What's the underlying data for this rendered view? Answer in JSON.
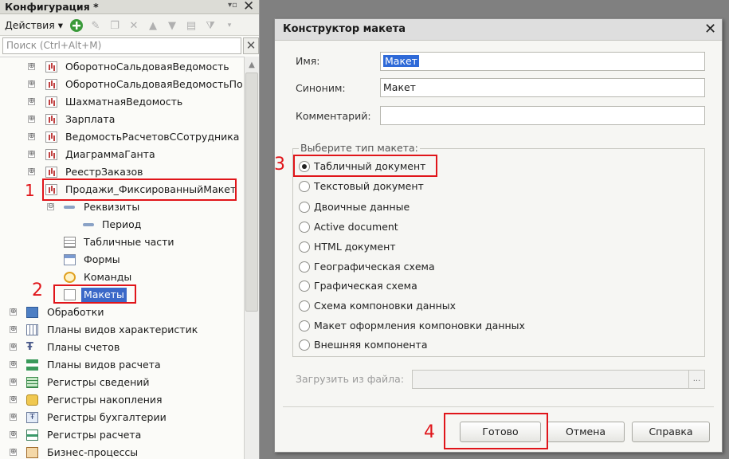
{
  "config_panel": {
    "title": "Конфигурация *",
    "actions_label": "Действия",
    "search_placeholder": "Поиск (Ctrl+Alt+M)",
    "tree": [
      {
        "label": "ОборотноСальдоваяВедомость",
        "icon": "report-icon",
        "expander": "⊕"
      },
      {
        "label": "ОборотноСальдоваяВедомостьПо",
        "icon": "report-icon",
        "expander": "⊕"
      },
      {
        "label": "ШахматнаяВедомость",
        "icon": "report-icon",
        "expander": "⊕"
      },
      {
        "label": "Зарплата",
        "icon": "report-icon",
        "expander": "⊕"
      },
      {
        "label": "ВедомостьРасчетовССотрудника",
        "icon": "report-icon",
        "expander": "⊕"
      },
      {
        "label": "ДиаграммаГанта",
        "icon": "report-icon",
        "expander": "⊕"
      },
      {
        "label": "РеестрЗаказов",
        "icon": "report-icon",
        "expander": "⊕"
      },
      {
        "label": "Продажи_ФиксированныйМакет",
        "icon": "report-icon",
        "expander": "⊖"
      },
      {
        "label": "Реквизиты",
        "icon": "attribute-icon",
        "expander": "⊖"
      },
      {
        "label": "Период",
        "icon": "attribute-icon",
        "expander": ""
      },
      {
        "label": "Табличные части",
        "icon": "tabular-section-icon",
        "expander": ""
      },
      {
        "label": "Формы",
        "icon": "form-icon",
        "expander": ""
      },
      {
        "label": "Команды",
        "icon": "command-icon",
        "expander": ""
      },
      {
        "label": "Макеты",
        "icon": "template-icon",
        "expander": ""
      },
      {
        "label": "Обработки",
        "icon": "data-processor-icon",
        "expander": "⊕"
      },
      {
        "label": "Планы видов характеристик",
        "icon": "chart-of-characteristics-icon",
        "expander": "⊕"
      },
      {
        "label": "Планы счетов",
        "icon": "chart-of-accounts-icon",
        "expander": "⊕"
      },
      {
        "label": "Планы видов расчета",
        "icon": "chart-of-calculation-icon",
        "expander": "⊕"
      },
      {
        "label": "Регистры сведений",
        "icon": "information-register-icon",
        "expander": "⊕"
      },
      {
        "label": "Регистры накопления",
        "icon": "accumulation-register-icon",
        "expander": "⊕"
      },
      {
        "label": "Регистры бухгалтерии",
        "icon": "accounting-register-icon",
        "expander": "⊕"
      },
      {
        "label": "Регистры расчета",
        "icon": "calculation-register-icon",
        "expander": "⊕"
      },
      {
        "label": "Бизнес-процессы",
        "icon": "business-process-icon",
        "expander": "⊕"
      }
    ]
  },
  "annotations": {
    "n1": "1",
    "n2": "2",
    "n3": "3",
    "n4": "4"
  },
  "dialog": {
    "title": "Конструктор макета",
    "name_label": "Имя:",
    "name_value": "Макет",
    "synonym_label": "Синоним:",
    "synonym_value": "Макет",
    "comment_label": "Комментарий:",
    "comment_value": "",
    "type_group_title": "Выберите тип макета:",
    "template_types": [
      {
        "label": "Табличный документ",
        "selected": true
      },
      {
        "label": "Текстовый документ",
        "selected": false
      },
      {
        "label": "Двоичные данные",
        "selected": false
      },
      {
        "label": "Active document",
        "selected": false
      },
      {
        "label": "HTML документ",
        "selected": false
      },
      {
        "label": "Географическая схема",
        "selected": false
      },
      {
        "label": "Графическая схема",
        "selected": false
      },
      {
        "label": "Схема компоновки данных",
        "selected": false
      },
      {
        "label": "Макет оформления компоновки данных",
        "selected": false
      },
      {
        "label": "Внешняя компонента",
        "selected": false
      }
    ],
    "load_from_file_label": "Загрузить из файла:",
    "load_from_file_button": "...",
    "buttons": {
      "ok": "Готово",
      "cancel": "Отмена",
      "help": "Справка"
    }
  },
  "colors": {
    "highlight_red": "#e0151a",
    "selection_blue": "#2f6ad8"
  }
}
